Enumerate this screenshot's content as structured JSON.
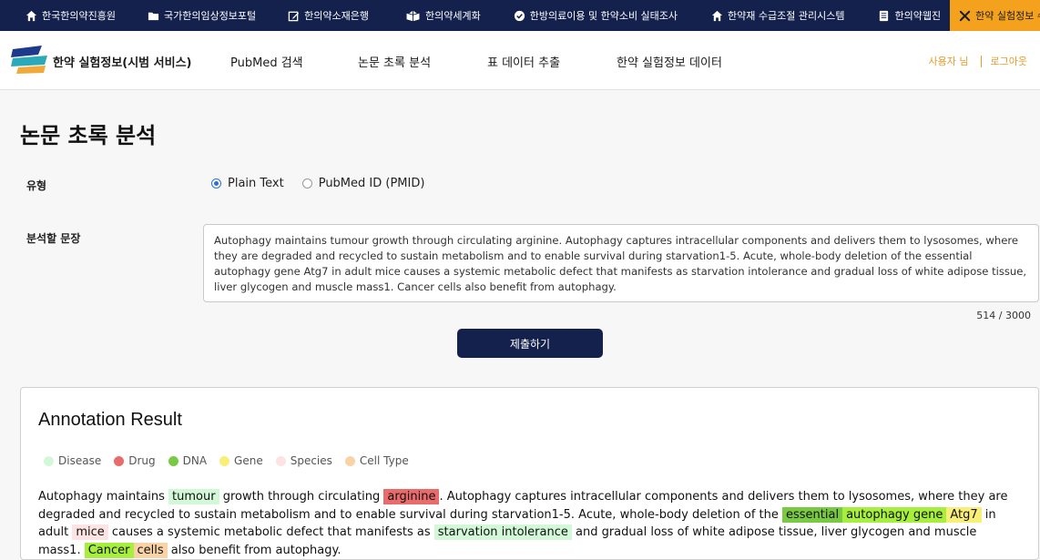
{
  "topbar": {
    "items": [
      {
        "label": "한국한의약진흥원",
        "icon": "home-icon"
      },
      {
        "label": "국가한의임상정보포털",
        "icon": "folder-icon"
      },
      {
        "label": "한의약소재은행",
        "icon": "edit-icon"
      },
      {
        "label": "한의약세계화",
        "icon": "book-open-icon"
      },
      {
        "label": "한방의료이용 및 한약소비 실태조사",
        "icon": "check-circle-icon"
      },
      {
        "label": "한약재 수급조절 관리시스템",
        "icon": "home-icon"
      },
      {
        "label": "한의약웹진",
        "icon": "book-icon"
      },
      {
        "label": "한약 실험정보 수집 도구",
        "icon": "tools-icon"
      }
    ]
  },
  "header": {
    "brand": "한약 실험정보(시범 서비스)",
    "nav": [
      "PubMed 검색",
      "논문 초록 분석",
      "표 데이터 추출",
      "한약 실험정보 데이터"
    ],
    "user": "사용자 님",
    "logout": "로그아웃"
  },
  "page": {
    "title": "논문 초록 분석",
    "type_label": "유형",
    "options": [
      "Plain Text",
      "PubMed ID (PMID)"
    ],
    "selected_option": "Plain Text",
    "text_label": "분석할 문장",
    "text_value": "Autophagy maintains tumour growth through circulating arginine. Autophagy captures intracellular components and delivers them to lysosomes, where they are degraded and recycled to sustain metabolism and to enable survival during starvation1-5. Acute, whole-body deletion of the essential autophagy gene Atg7 in adult mice causes a systemic metabolic defect that manifests as starvation intolerance and gradual loss of white adipose tissue, liver glycogen and muscle mass1. Cancer cells also benefit from autophagy.",
    "counter": "514 / 3000",
    "submit": "제출하기"
  },
  "result": {
    "title": "Annotation Result",
    "legend": [
      {
        "label": "Disease",
        "color": "#d3f8d8"
      },
      {
        "label": "Drug",
        "color": "#ea6b6b"
      },
      {
        "label": "DNA",
        "color": "#7ac943"
      },
      {
        "label": "Gene",
        "color": "#f8ee78"
      },
      {
        "label": "Species",
        "color": "#fde3e3"
      },
      {
        "label": "Cell Type",
        "color": "#f9d2a6"
      }
    ],
    "segments": [
      {
        "text": "Autophagy maintains "
      },
      {
        "text": "tumour",
        "type": "Disease"
      },
      {
        "text": " growth through circulating "
      },
      {
        "text": "arginine",
        "type": "Drug"
      },
      {
        "text": ". Autophagy captures intracellular components and delivers them to lysosomes, where they are degraded and recycled to sustain metabolism and to enable survival during starvation1-5. Acute, whole-body deletion of the "
      },
      {
        "text": "essential",
        "type": "DNA"
      },
      {
        "text": "autophagy gene",
        "type": "DNA-light"
      },
      {
        "text": "Atg7",
        "type": "Gene"
      },
      {
        "text": " in adult "
      },
      {
        "text": "mice",
        "type": "Species"
      },
      {
        "text": " causes a systemic metabolic defect that manifests as "
      },
      {
        "text": "starvation intolerance",
        "type": "Disease"
      },
      {
        "text": " and gradual loss of white adipose tissue, liver glycogen and muscle mass1. "
      },
      {
        "text": "Cancer",
        "type": "DNA-light"
      },
      {
        "text": "cells",
        "type": "Cell Type"
      },
      {
        "text": " also benefit from autophagy."
      }
    ]
  }
}
